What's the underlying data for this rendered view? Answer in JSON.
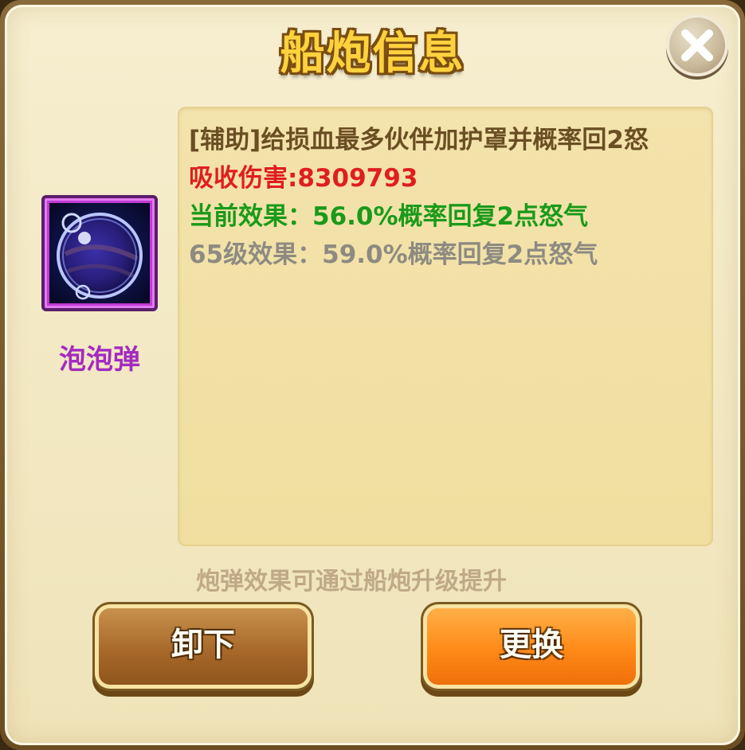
{
  "dialog": {
    "title": "船炮信息"
  },
  "item": {
    "name": "泡泡弹",
    "icon": "bubble-orb-icon",
    "rarity_color": "#c23bd6"
  },
  "description": {
    "type_line": "[辅助]给损血最多伙伴加护罩并概率回2怒",
    "absorb_label": "吸收伤害:",
    "absorb_value": "8309793",
    "current_effect": "当前效果：56.0%概率回复2点怒气",
    "next_effect": "65级效果：59.0%概率回复2点怒气"
  },
  "hint": "炮弹效果可通过船炮升级提升",
  "buttons": {
    "unequip_label": "卸下",
    "replace_label": "更换"
  },
  "colors": {
    "absorb": "#e01e1e",
    "current": "#1a9a1a",
    "next": "#8e8a82",
    "title": "#ffd23d"
  }
}
